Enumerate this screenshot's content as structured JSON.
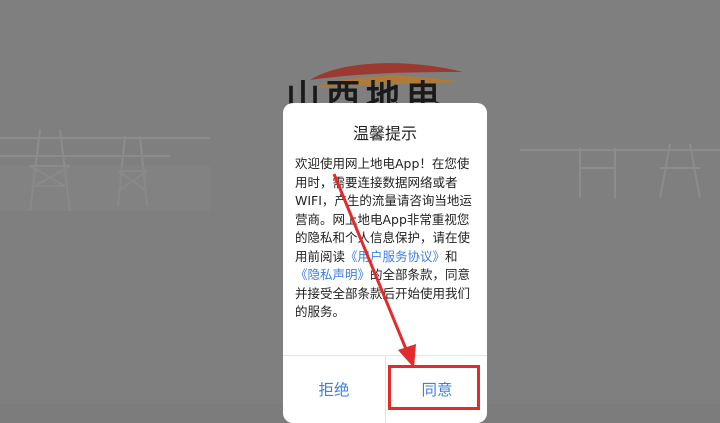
{
  "dialog": {
    "title": "温馨提示",
    "body": {
      "p1": "欢迎使用网上地电App！在您使用时，需要连接数据网络或者WIFI，产生的流量请咨询当地运营商。网上地电App非常重视您的隐私和个人信息保护，请在使用前阅读",
      "link_user_agreement": "《用户服务协议》",
      "and": "和",
      "link_privacy": "《隐私声明》",
      "p2": "的全部条款，同意并接受全部条款后开始使用我们的服务。"
    },
    "buttons": {
      "reject": "拒绝",
      "agree": "同意"
    }
  },
  "background": {
    "logo_text": "山西地电"
  },
  "colors": {
    "overlay": "#7f7f7f",
    "link": "#3d7fe8",
    "annotation": "#e32b2b",
    "logo_red": "#c8302c",
    "logo_orange": "#e8a23a"
  },
  "icons": {
    "logo": "flame-swoosh-logo",
    "towers": "power-tower-silhouettes",
    "annotation_arrow": "red-arrow-annotation"
  }
}
